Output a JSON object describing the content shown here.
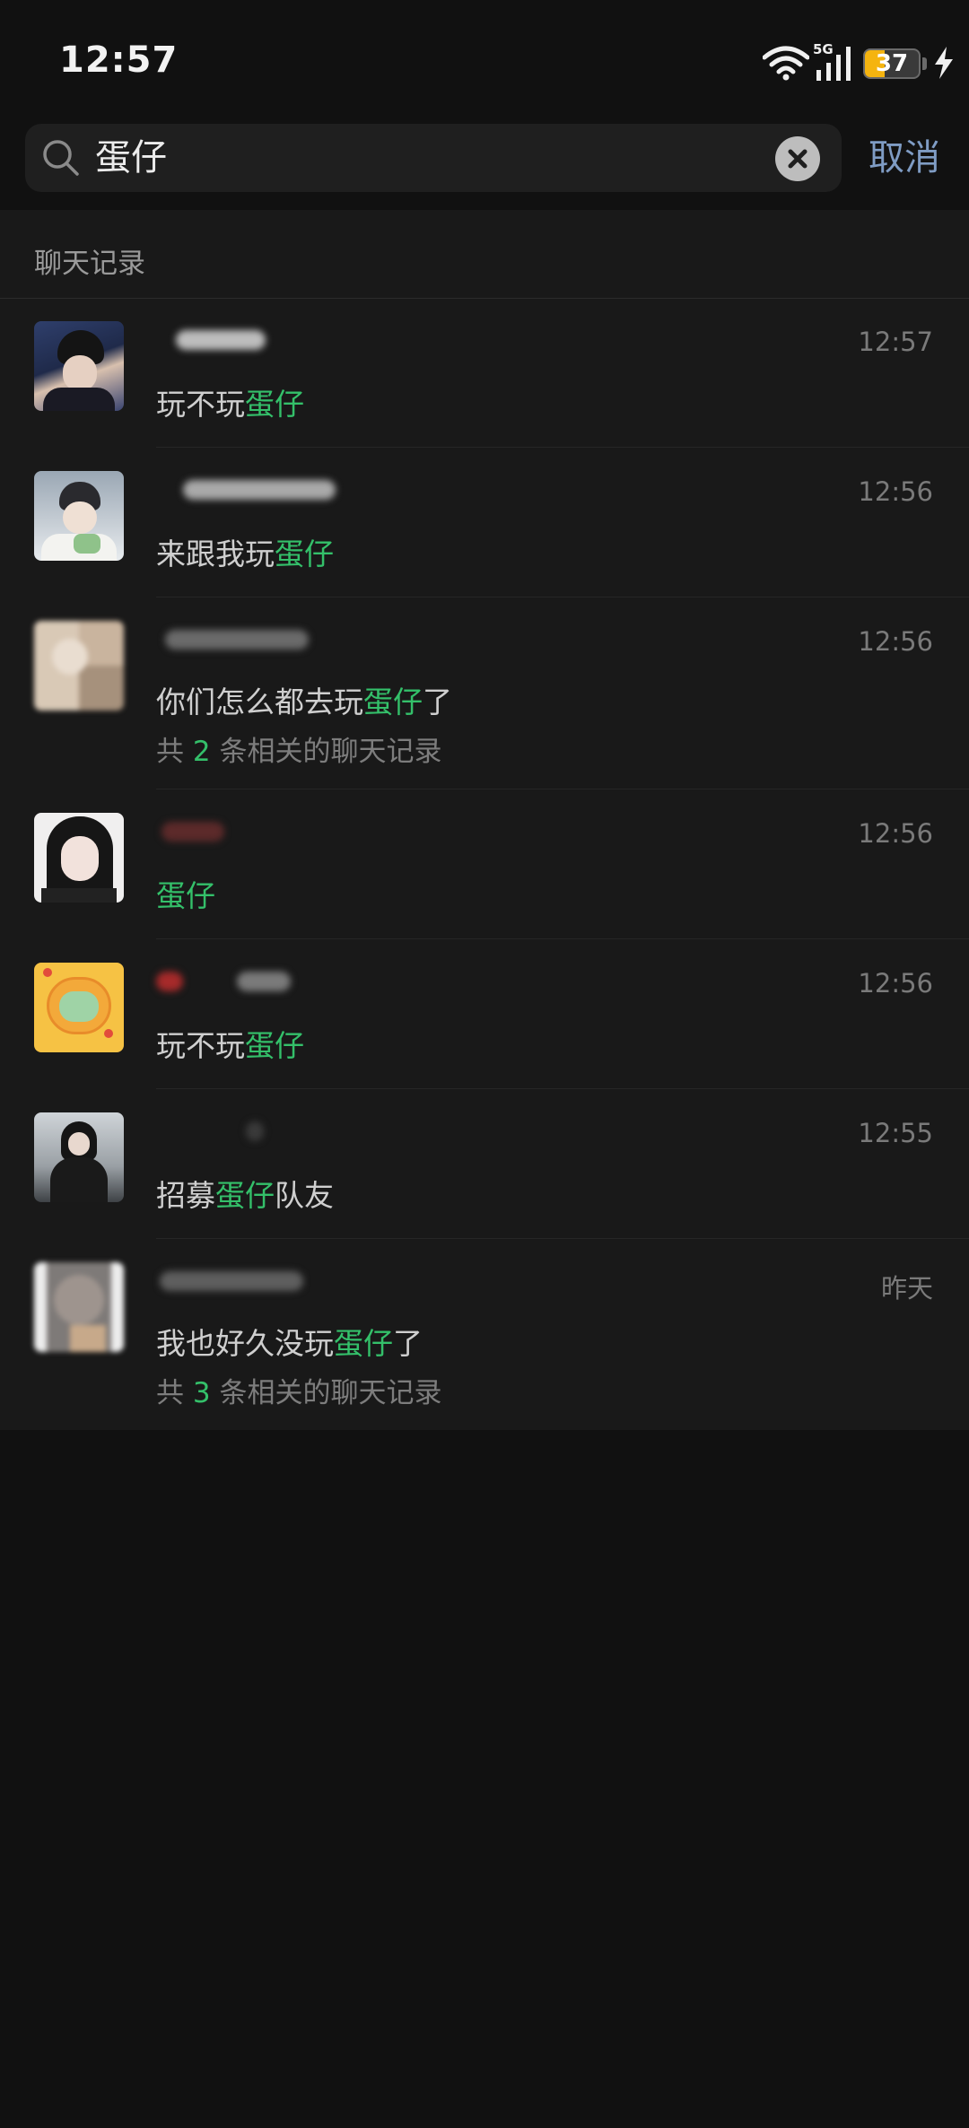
{
  "status_bar": {
    "time": "12:57",
    "network": "5G",
    "battery": "37",
    "battery_level": 0.37,
    "icons": [
      "wifi-icon",
      "signal-icon",
      "battery-icon",
      "charging-icon"
    ]
  },
  "search": {
    "query": "蛋仔",
    "cancel_label": "取消",
    "icons": [
      "search-icon",
      "clear-icon"
    ]
  },
  "section": {
    "title": "聊天记录"
  },
  "keyword": "蛋仔",
  "colors": {
    "highlight": "#34c06a",
    "link": "#7f9cc4",
    "background": "#111111",
    "panel": "#191919",
    "battery": "#f5b40f"
  },
  "results": [
    {
      "time": "12:57",
      "pre": "玩不玩",
      "hit": "蛋仔",
      "post": "",
      "related_prefix": "",
      "related_count": "",
      "related_suffix": ""
    },
    {
      "time": "12:56",
      "pre": "来跟我玩",
      "hit": "蛋仔",
      "post": "",
      "related_prefix": "",
      "related_count": "",
      "related_suffix": ""
    },
    {
      "time": "12:56",
      "pre": "你们怎么都去玩",
      "hit": "蛋仔",
      "post": "了",
      "related_prefix": "共 ",
      "related_count": "2",
      "related_suffix": " 条相关的聊天记录"
    },
    {
      "time": "12:56",
      "pre": "",
      "hit": "蛋仔",
      "post": "",
      "related_prefix": "",
      "related_count": "",
      "related_suffix": ""
    },
    {
      "time": "12:56",
      "pre": "玩不玩",
      "hit": "蛋仔",
      "post": "",
      "related_prefix": "",
      "related_count": "",
      "related_suffix": ""
    },
    {
      "time": "12:55",
      "pre": "招募",
      "hit": "蛋仔",
      "post": "队友",
      "related_prefix": "",
      "related_count": "",
      "related_suffix": ""
    },
    {
      "time": "昨天",
      "pre": "我也好久没玩",
      "hit": "蛋仔",
      "post": "了",
      "related_prefix": "共 ",
      "related_count": "3",
      "related_suffix": " 条相关的聊天记录"
    }
  ]
}
